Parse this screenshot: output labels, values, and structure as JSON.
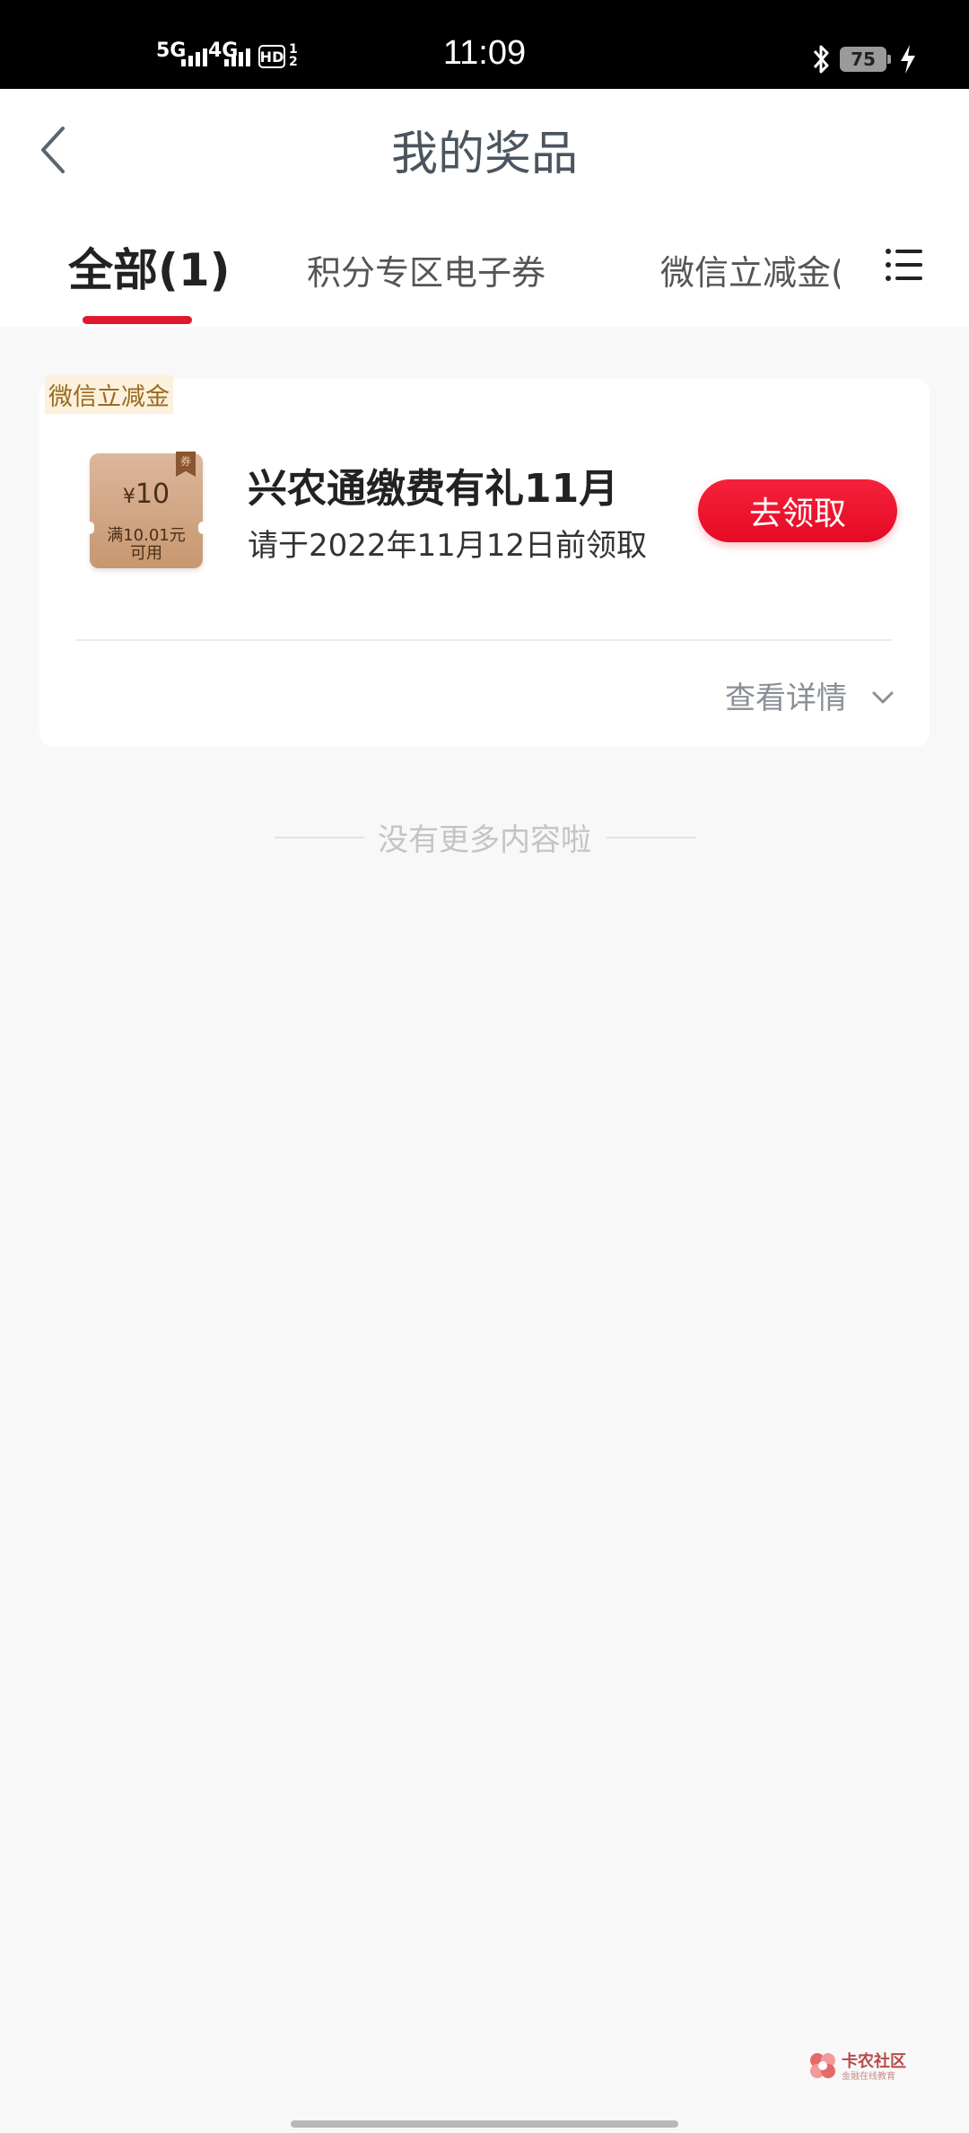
{
  "status_bar": {
    "net1": "5G",
    "net2": "4G",
    "hd": "HD",
    "hd_sub": "1\n2",
    "time": "11:09",
    "battery": "75"
  },
  "header": {
    "title": "我的奖品"
  },
  "tabs": [
    {
      "label": "全部(1)",
      "active": true
    },
    {
      "label": "积分专区电子券",
      "active": false
    },
    {
      "label": "微信立减金(",
      "active": false
    }
  ],
  "prize_card": {
    "tag": "微信立减金",
    "coupon": {
      "currency": "¥",
      "amount": "10",
      "condition_line1": "满10.01元",
      "condition_line2": "可用",
      "ribbon": "券"
    },
    "name": "兴农通缴费有礼11月",
    "deadline": "请于2022年11月12日前领取",
    "claim_button": "去领取",
    "details_link": "查看详情"
  },
  "list_end_text": "没有更多内容啦",
  "watermark": {
    "title": "卡农社区",
    "subtitle": "金融在线教育"
  },
  "colors": {
    "accent": "#e01830",
    "tag_bg": "#fbf1dc",
    "tag_text": "#9a6a22"
  }
}
